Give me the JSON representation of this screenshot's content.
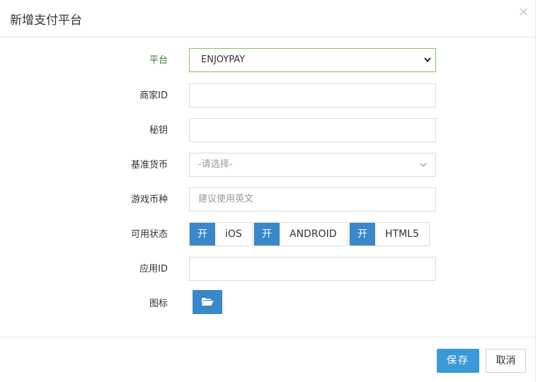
{
  "dialog": {
    "title": "新增支付平台",
    "close_glyph": "×"
  },
  "form": {
    "platform": {
      "label": "平台",
      "value": "ENJOYPAY"
    },
    "merchant_id": {
      "label": "商家ID",
      "value": ""
    },
    "secret_key": {
      "label": "秘钥",
      "value": ""
    },
    "base_currency": {
      "label": "基准货币",
      "value": "-请选择-"
    },
    "game_currency": {
      "label": "游戏币种",
      "placeholder": "建议使用英文"
    },
    "availability": {
      "label": "可用状态",
      "toggles": [
        {
          "on_label": "开",
          "name": "iOS"
        },
        {
          "on_label": "开",
          "name": "ANDROID"
        },
        {
          "on_label": "开",
          "name": "HTML5"
        }
      ]
    },
    "app_id": {
      "label": "应用ID",
      "value": ""
    },
    "icon": {
      "label": "图标",
      "button_icon": "folder-open-icon"
    }
  },
  "footer": {
    "save_label": "保存",
    "cancel_label": "取消"
  },
  "colors": {
    "primary": "#3a87c9",
    "save": "#3a9ad9",
    "valid_label": "#3c763d",
    "valid_border": "#8bbf67"
  }
}
